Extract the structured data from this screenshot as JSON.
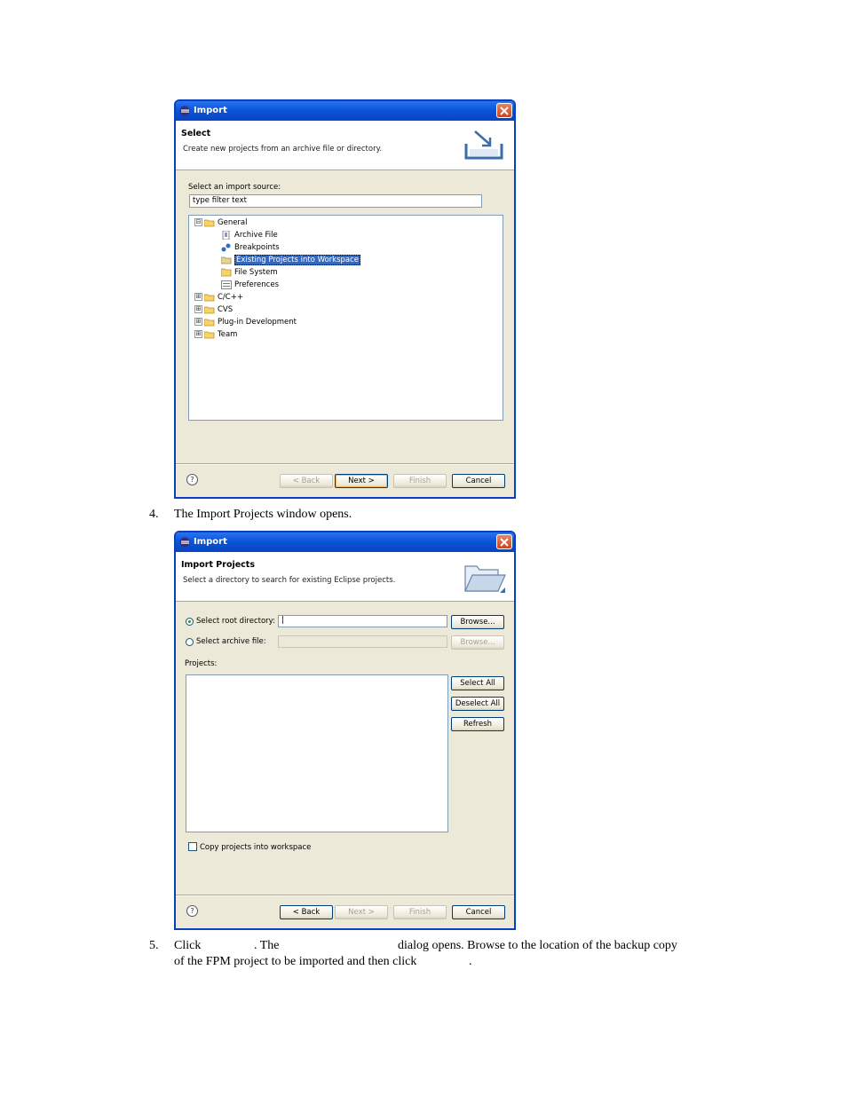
{
  "dialog1": {
    "title": "Import",
    "banner_title": "Select",
    "banner_desc": "Create new projects from an archive file or directory.",
    "source_label": "Select an import source:",
    "filter_value": "type filter text",
    "tree": [
      {
        "label": "General",
        "expander": "⊟",
        "icon": "folder-open-icon"
      },
      {
        "label": "Archive File",
        "icon": "archive-file-icon"
      },
      {
        "label": "Breakpoints",
        "icon": "breakpoints-icon"
      },
      {
        "label": "Existing Projects into Workspace",
        "icon": "projects-icon",
        "selected": true
      },
      {
        "label": "File System",
        "icon": "folder-icon"
      },
      {
        "label": "Preferences",
        "icon": "preferences-icon"
      },
      {
        "label": "C/C++",
        "expander": "⊞",
        "icon": "folder-open-icon"
      },
      {
        "label": "CVS",
        "expander": "⊞",
        "icon": "folder-open-icon"
      },
      {
        "label": "Plug-in Development",
        "expander": "⊞",
        "icon": "folder-open-icon"
      },
      {
        "label": "Team",
        "expander": "⊞",
        "icon": "folder-open-icon"
      }
    ],
    "buttons": {
      "back": "< Back",
      "next": "Next >",
      "finish": "Finish",
      "cancel": "Cancel"
    },
    "help": "?"
  },
  "step4": {
    "number": "4.",
    "text": "The Import Projects window opens."
  },
  "dialog2": {
    "title": "Import",
    "banner_title": "Import Projects",
    "banner_desc": "Select a directory to search for existing Eclipse projects.",
    "root_label": "Select root directory:",
    "root_value": "|",
    "archive_label": "Select archive file:",
    "browse": "Browse...",
    "projects_label": "Projects:",
    "select_all": "Select All",
    "deselect_all": "Deselect All",
    "refresh": "Refresh",
    "copy_label": "Copy projects into workspace",
    "buttons": {
      "back": "< Back",
      "next": "Next >",
      "finish": "Finish",
      "cancel": "Cancel"
    },
    "help": "?"
  },
  "step5": {
    "number": "5.",
    "click": "Click",
    "the": ".  The",
    "rest": "dialog opens.  Browse to the location of the backup copy",
    "line2": "of the FPM project to be imported and then click",
    "end": "."
  },
  "colors": {
    "titlebar": "#0a55d8",
    "selection": "#316ac5",
    "dialog_bg": "#ece9d8"
  }
}
